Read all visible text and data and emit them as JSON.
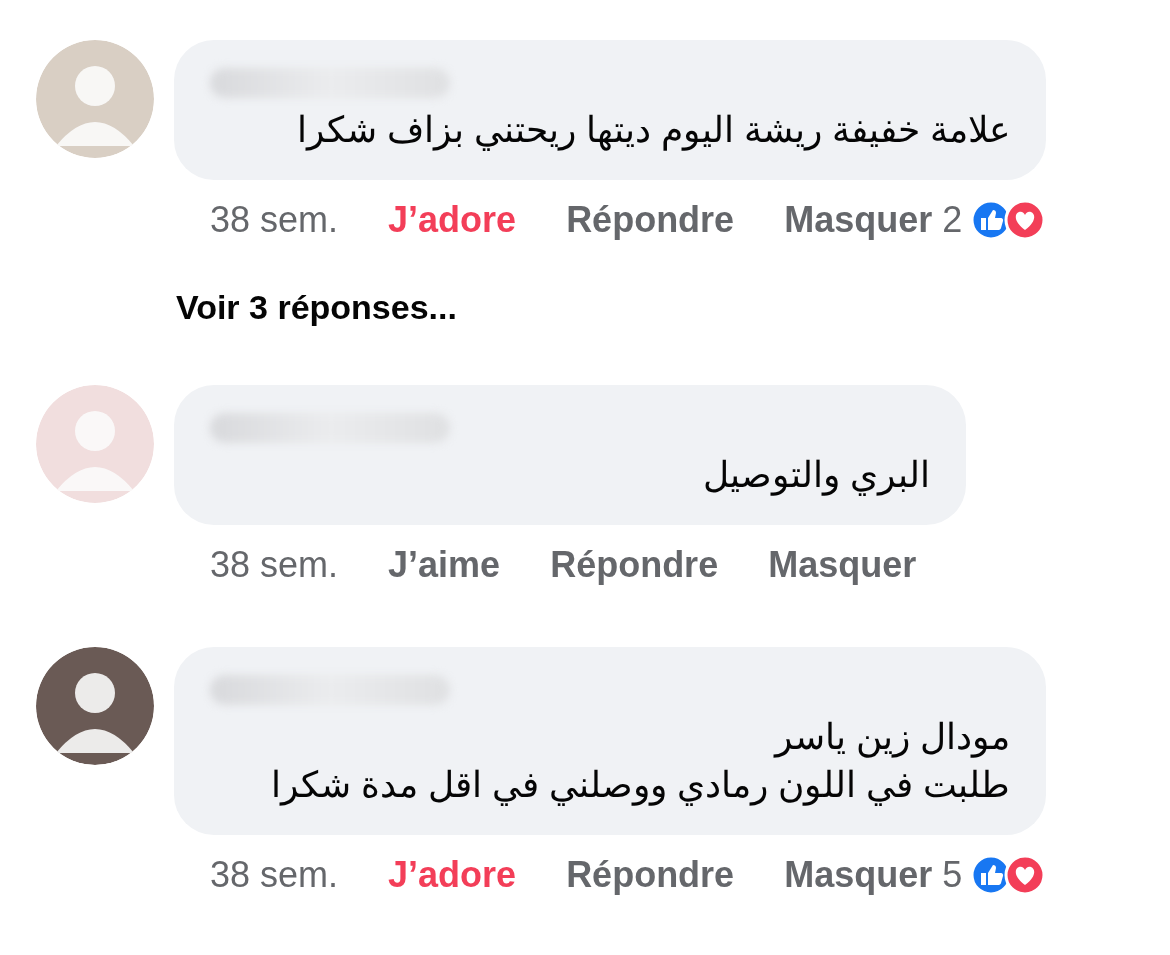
{
  "comments": [
    {
      "lines": [
        "علامة خفيفة ريشة اليوم ديتها ريحتني بزاف شكرا"
      ],
      "time": "38 sem.",
      "react_label": "J’adore",
      "reacted": true,
      "reply_label": "Répondre",
      "hide_label": "Masquer",
      "reaction_count": "2",
      "reaction_icons": [
        {
          "kind": "like"
        },
        {
          "kind": "love"
        }
      ],
      "more_replies": "Voir 3 réponses..."
    },
    {
      "lines": [
        "البري والتوصيل"
      ],
      "time": "38 sem.",
      "react_label": "J’aime",
      "reacted": false,
      "reply_label": "Répondre",
      "hide_label": "Masquer"
    },
    {
      "lines": [
        "مودال زين ياسر",
        "طلبت في اللون رمادي ووصلني في اقل مدة شكرا"
      ],
      "time": "38 sem.",
      "react_label": "J’adore",
      "reacted": true,
      "reply_label": "Répondre",
      "hide_label": "Masquer",
      "reaction_count": "5",
      "reaction_icons": [
        {
          "kind": "like"
        },
        {
          "kind": "love"
        }
      ]
    }
  ]
}
